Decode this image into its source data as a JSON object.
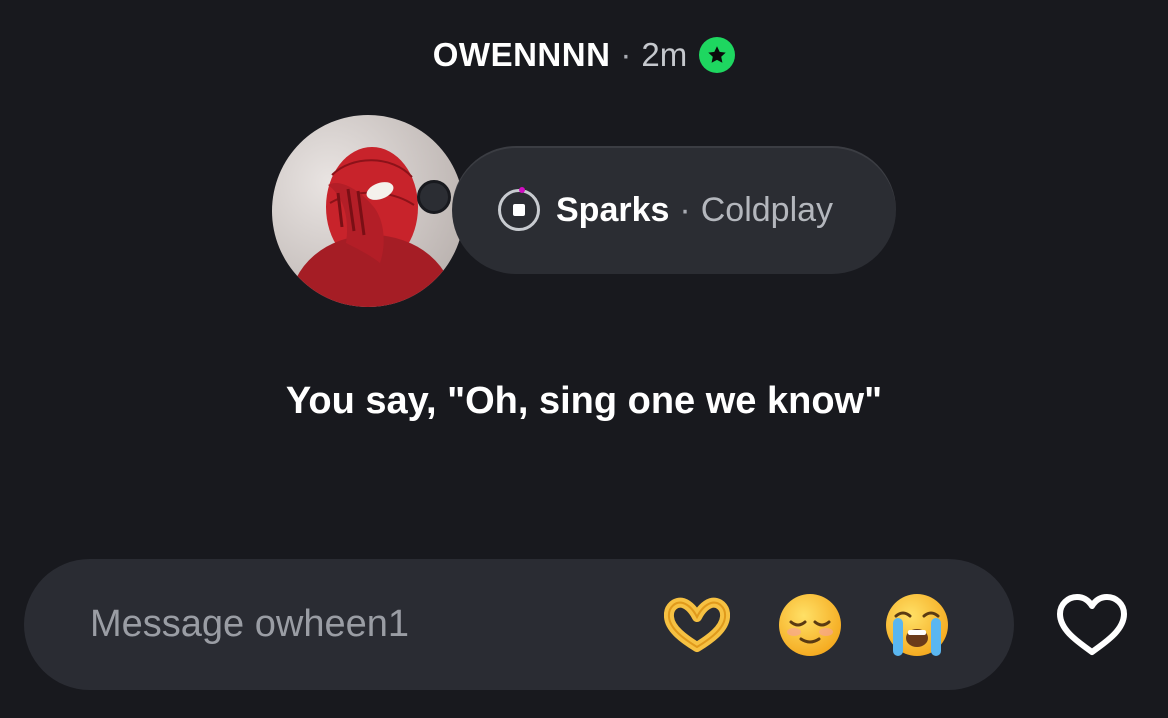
{
  "header": {
    "username": "OWENNNN",
    "separator": "·",
    "time": "2m",
    "badge_icon": "star-icon",
    "badge_color": "#1ed760"
  },
  "note": {
    "song_title": "Sparks",
    "separator": "·",
    "artist": "Coldplay",
    "play_icon": "stop-icon"
  },
  "message": {
    "text": "You say, \"Oh, sing one we know\""
  },
  "composer": {
    "placeholder": "Message owheen1",
    "reactions": [
      "heart-hands-emoji",
      "relieved-face-emoji",
      "loudly-crying-face-emoji"
    ],
    "like_icon": "heart-outline-icon"
  },
  "colors": {
    "background": "#18191e",
    "bubble": "#2b2d33",
    "composer": "#2a2c33",
    "accent_green": "#1ed760",
    "progress_pink": "#d10ec3"
  }
}
